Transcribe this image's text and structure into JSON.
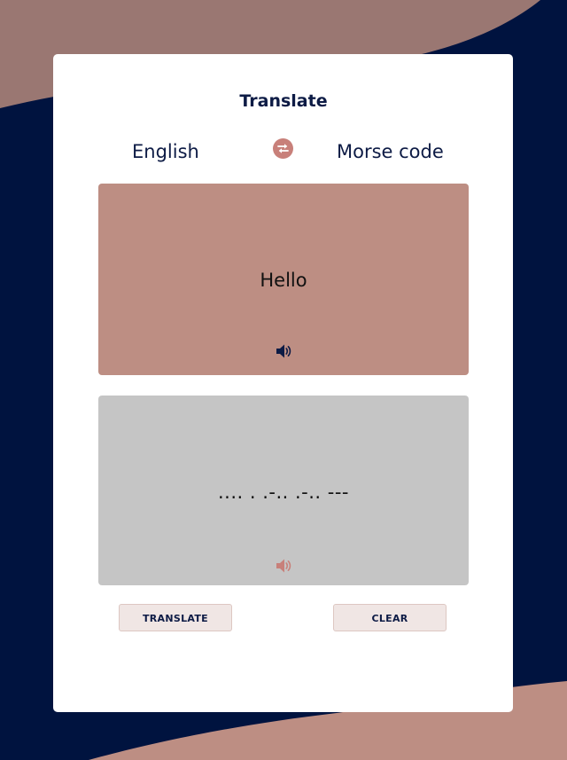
{
  "header": {
    "title": "Translate"
  },
  "languages": {
    "from": "English",
    "to": "Morse code",
    "swap_icon": "swap-arrows-icon"
  },
  "input_panel": {
    "text": "Hello",
    "speaker_icon": "speaker-icon"
  },
  "output_panel": {
    "text": ".... . .-.. .-.. ---",
    "speaker_icon": "speaker-icon"
  },
  "buttons": {
    "translate_label": "TRANSLATE",
    "clear_label": "CLEAR"
  },
  "colors": {
    "background": "#00133f",
    "accent_blob": "#bd8e83",
    "top_blob": "#9a7772",
    "output_panel": "#c5c5c5",
    "swap_button": "#c8807a",
    "text_dark": "#0d1b45"
  }
}
